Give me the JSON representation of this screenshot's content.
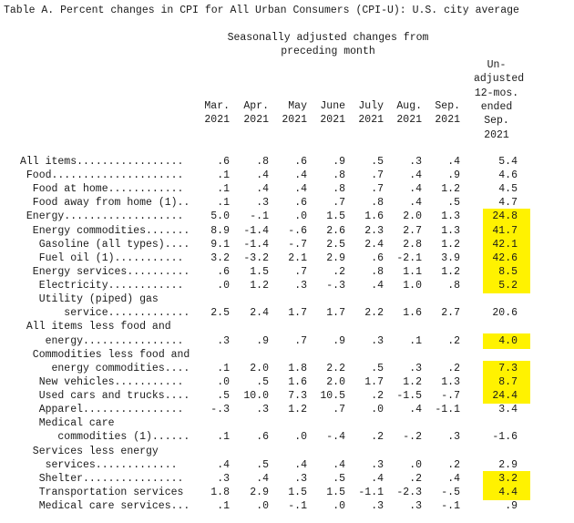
{
  "title": "Table A. Percent changes in CPI for All Urban Consumers (CPI-U): U.S. city average",
  "group_header": [
    "Seasonally adjusted changes from",
    "preceding month"
  ],
  "unadjusted_header": [
    "Un-",
    "adjusted",
    "12-mos.",
    "ended",
    "Sep.",
    "2021"
  ],
  "months": [
    {
      "m": "Mar.",
      "y": "2021"
    },
    {
      "m": "Apr.",
      "y": "2021"
    },
    {
      "m": "May",
      "y": "2021"
    },
    {
      "m": "June",
      "y": "2021"
    },
    {
      "m": "July",
      "y": "2021"
    },
    {
      "m": "Aug.",
      "y": "2021"
    },
    {
      "m": "Sep.",
      "y": "2021"
    }
  ],
  "highlight_color": "#fff200",
  "rows": [
    {
      "lines": [
        "All items................."
      ],
      "indent": [
        0
      ],
      "values": [
        ".6",
        ".8",
        ".6",
        ".9",
        ".5",
        ".3",
        ".4",
        "5.4"
      ],
      "highlight": false
    },
    {
      "lines": [
        "Food....................."
      ],
      "indent": [
        1
      ],
      "values": [
        ".1",
        ".4",
        ".4",
        ".8",
        ".7",
        ".4",
        ".9",
        "4.6"
      ],
      "highlight": false
    },
    {
      "lines": [
        "Food at home............"
      ],
      "indent": [
        2
      ],
      "values": [
        ".1",
        ".4",
        ".4",
        ".8",
        ".7",
        ".4",
        "1.2",
        "4.5"
      ],
      "highlight": false
    },
    {
      "lines": [
        "Food away from home (1).."
      ],
      "indent": [
        2
      ],
      "values": [
        ".1",
        ".3",
        ".6",
        ".7",
        ".8",
        ".4",
        ".5",
        "4.7"
      ],
      "highlight": false
    },
    {
      "lines": [
        "Energy..................."
      ],
      "indent": [
        1
      ],
      "values": [
        "5.0",
        "-.1",
        ".0",
        "1.5",
        "1.6",
        "2.0",
        "1.3",
        "24.8"
      ],
      "highlight": true
    },
    {
      "lines": [
        "Energy commodities......."
      ],
      "indent": [
        2
      ],
      "values": [
        "8.9",
        "-1.4",
        "-.6",
        "2.6",
        "2.3",
        "2.7",
        "1.3",
        "41.7"
      ],
      "highlight": true
    },
    {
      "lines": [
        "Gasoline (all types)...."
      ],
      "indent": [
        3
      ],
      "values": [
        "9.1",
        "-1.4",
        "-.7",
        "2.5",
        "2.4",
        "2.8",
        "1.2",
        "42.1"
      ],
      "highlight": true
    },
    {
      "lines": [
        "Fuel oil (1)..........."
      ],
      "indent": [
        3
      ],
      "values": [
        "3.2",
        "-3.2",
        "2.1",
        "2.9",
        ".6",
        "-2.1",
        "3.9",
        "42.6"
      ],
      "highlight": true
    },
    {
      "lines": [
        "Energy services.........."
      ],
      "indent": [
        2
      ],
      "values": [
        ".6",
        "1.5",
        ".7",
        ".2",
        ".8",
        "1.1",
        "1.2",
        "8.5"
      ],
      "highlight": true
    },
    {
      "lines": [
        "Electricity............"
      ],
      "indent": [
        3
      ],
      "values": [
        ".0",
        "1.2",
        ".3",
        "-.3",
        ".4",
        "1.0",
        ".8",
        "5.2"
      ],
      "highlight": true
    },
    {
      "lines": [
        "Utility (piped) gas",
        "service............."
      ],
      "indent": [
        3,
        7
      ],
      "values": [
        "2.5",
        "2.4",
        "1.7",
        "1.7",
        "2.2",
        "1.6",
        "2.7",
        "20.6"
      ],
      "highlight": false
    },
    {
      "lines": [
        "All items less food and",
        "energy................"
      ],
      "indent": [
        1,
        4
      ],
      "values": [
        ".3",
        ".9",
        ".7",
        ".9",
        ".3",
        ".1",
        ".2",
        "4.0"
      ],
      "highlight": true
    },
    {
      "lines": [
        "Commodities less food and",
        "energy commodities...."
      ],
      "indent": [
        2,
        5
      ],
      "values": [
        ".1",
        "2.0",
        "1.8",
        "2.2",
        ".5",
        ".3",
        ".2",
        "7.3"
      ],
      "highlight": true
    },
    {
      "lines": [
        "New vehicles..........."
      ],
      "indent": [
        3
      ],
      "values": [
        ".0",
        ".5",
        "1.6",
        "2.0",
        "1.7",
        "1.2",
        "1.3",
        "8.7"
      ],
      "highlight": true
    },
    {
      "lines": [
        "Used cars and trucks...."
      ],
      "indent": [
        3
      ],
      "values": [
        ".5",
        "10.0",
        "7.3",
        "10.5",
        ".2",
        "-1.5",
        "-.7",
        "24.4"
      ],
      "highlight": true
    },
    {
      "lines": [
        "Apparel................"
      ],
      "indent": [
        3
      ],
      "values": [
        "-.3",
        ".3",
        "1.2",
        ".7",
        ".0",
        ".4",
        "-1.1",
        "3.4"
      ],
      "highlight": false
    },
    {
      "lines": [
        "Medical care",
        "commodities (1)......"
      ],
      "indent": [
        3,
        6
      ],
      "values": [
        ".1",
        ".6",
        ".0",
        "-.4",
        ".2",
        "-.2",
        ".3",
        "-1.6"
      ],
      "highlight": false
    },
    {
      "lines": [
        "Services less energy",
        "services............."
      ],
      "indent": [
        2,
        4
      ],
      "values": [
        ".4",
        ".5",
        ".4",
        ".4",
        ".3",
        ".0",
        ".2",
        "2.9"
      ],
      "highlight": false
    },
    {
      "lines": [
        "Shelter................"
      ],
      "indent": [
        3
      ],
      "values": [
        ".3",
        ".4",
        ".3",
        ".5",
        ".4",
        ".2",
        ".4",
        "3.2"
      ],
      "highlight": true
    },
    {
      "lines": [
        "Transportation services"
      ],
      "indent": [
        3
      ],
      "values": [
        "1.8",
        "2.9",
        "1.5",
        "1.5",
        "-1.1",
        "-2.3",
        "-.5",
        "4.4"
      ],
      "highlight": true
    },
    {
      "lines": [
        "Medical care services..."
      ],
      "indent": [
        3
      ],
      "values": [
        ".1",
        ".0",
        "-.1",
        ".0",
        ".3",
        ".3",
        "-.1",
        ".9"
      ],
      "highlight": false
    }
  ]
}
